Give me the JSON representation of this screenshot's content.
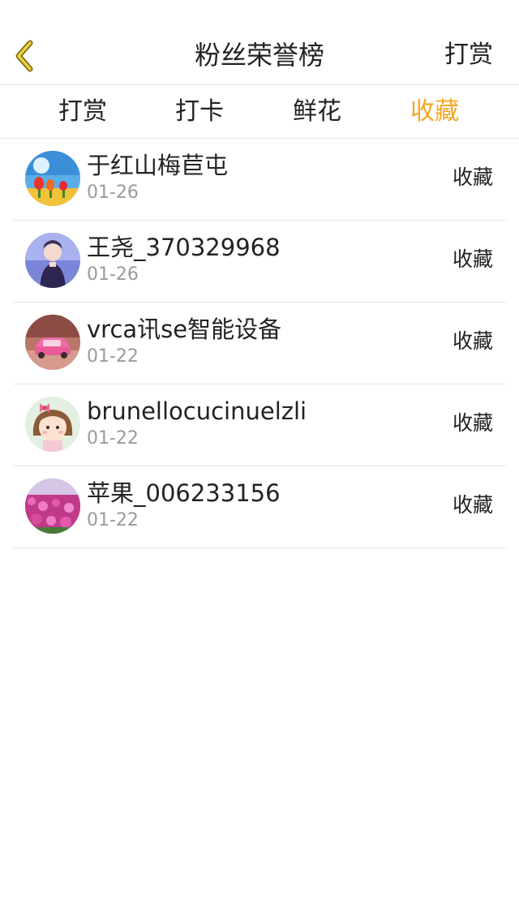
{
  "header": {
    "title": "粉丝荣誉榜",
    "action_label": "打赏"
  },
  "tabs": [
    {
      "label": "打赏",
      "active": false
    },
    {
      "label": "打卡",
      "active": false
    },
    {
      "label": "鲜花",
      "active": false
    },
    {
      "label": "收藏",
      "active": true
    }
  ],
  "colors": {
    "accent": "#f5a623",
    "text": "#222222",
    "muted": "#9b9b9b",
    "divider": "#e6e6e6"
  },
  "fans": [
    {
      "name": "于红山梅苣屯",
      "date": "01-26",
      "action": "收藏"
    },
    {
      "name": "王尧_370329968",
      "date": "01-26",
      "action": "收藏"
    },
    {
      "name": "vrca讯se智能设备",
      "date": "01-22",
      "action": "收藏"
    },
    {
      "name": "brunellocucinuelzli",
      "date": "01-22",
      "action": "收藏"
    },
    {
      "name": "苹果_006233156",
      "date": "01-22",
      "action": "收藏"
    }
  ]
}
